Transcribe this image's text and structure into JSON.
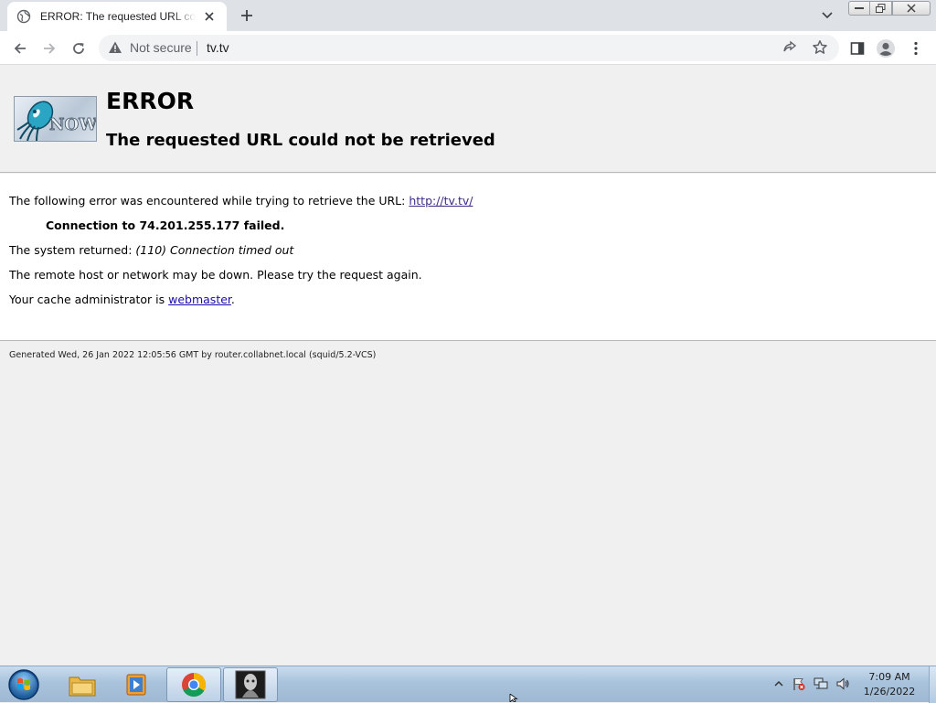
{
  "browser": {
    "tab_title": "ERROR: The requested URL could not be retrieved",
    "address_security": "Not secure",
    "address_url": "tv.tv"
  },
  "icons": {
    "favicon": "globe-icon",
    "tab_close": "close-icon",
    "new_tab": "plus-icon",
    "tab_search": "chevron-down-icon",
    "back": "arrow-left-icon",
    "forward": "arrow-right-icon",
    "reload": "reload-icon",
    "security": "warning-triangle-icon",
    "share": "share-icon",
    "bookmark": "star-icon",
    "side_panel": "side-panel-icon",
    "profile": "profile-icon",
    "menu": "kebab-menu-icon"
  },
  "page": {
    "logo_text": "NOW",
    "heading": "ERROR",
    "subheading": "The requested URL could not be retrieved",
    "line1_prefix": "The following error was encountered while trying to retrieve the URL: ",
    "line1_link": "http://tv.tv/",
    "line2": "Connection to 74.201.255.177 failed.",
    "line3_prefix": "The system returned: ",
    "line3_italic": "(110) Connection timed out",
    "line4": "The remote host or network may be down. Please try the request again.",
    "line5_prefix": "Your cache administrator is ",
    "line5_link": "webmaster",
    "line5_suffix": ".",
    "footer": "Generated Wed, 26 Jan 2022 12:05:56 GMT by router.collabnet.local (squid/5.2-VCS)"
  },
  "taskbar": {
    "items": [
      "start-orb",
      "file-explorer",
      "media-player",
      "google-chrome",
      "app-thumbnail"
    ],
    "clock_time": "7:09 AM",
    "clock_date": "1/26/2022"
  },
  "colors": {
    "link": "#1a0dab",
    "page_bg": "#f0f0f0",
    "content_bg": "#ffffff",
    "taskbar": "#a9c3dc"
  }
}
